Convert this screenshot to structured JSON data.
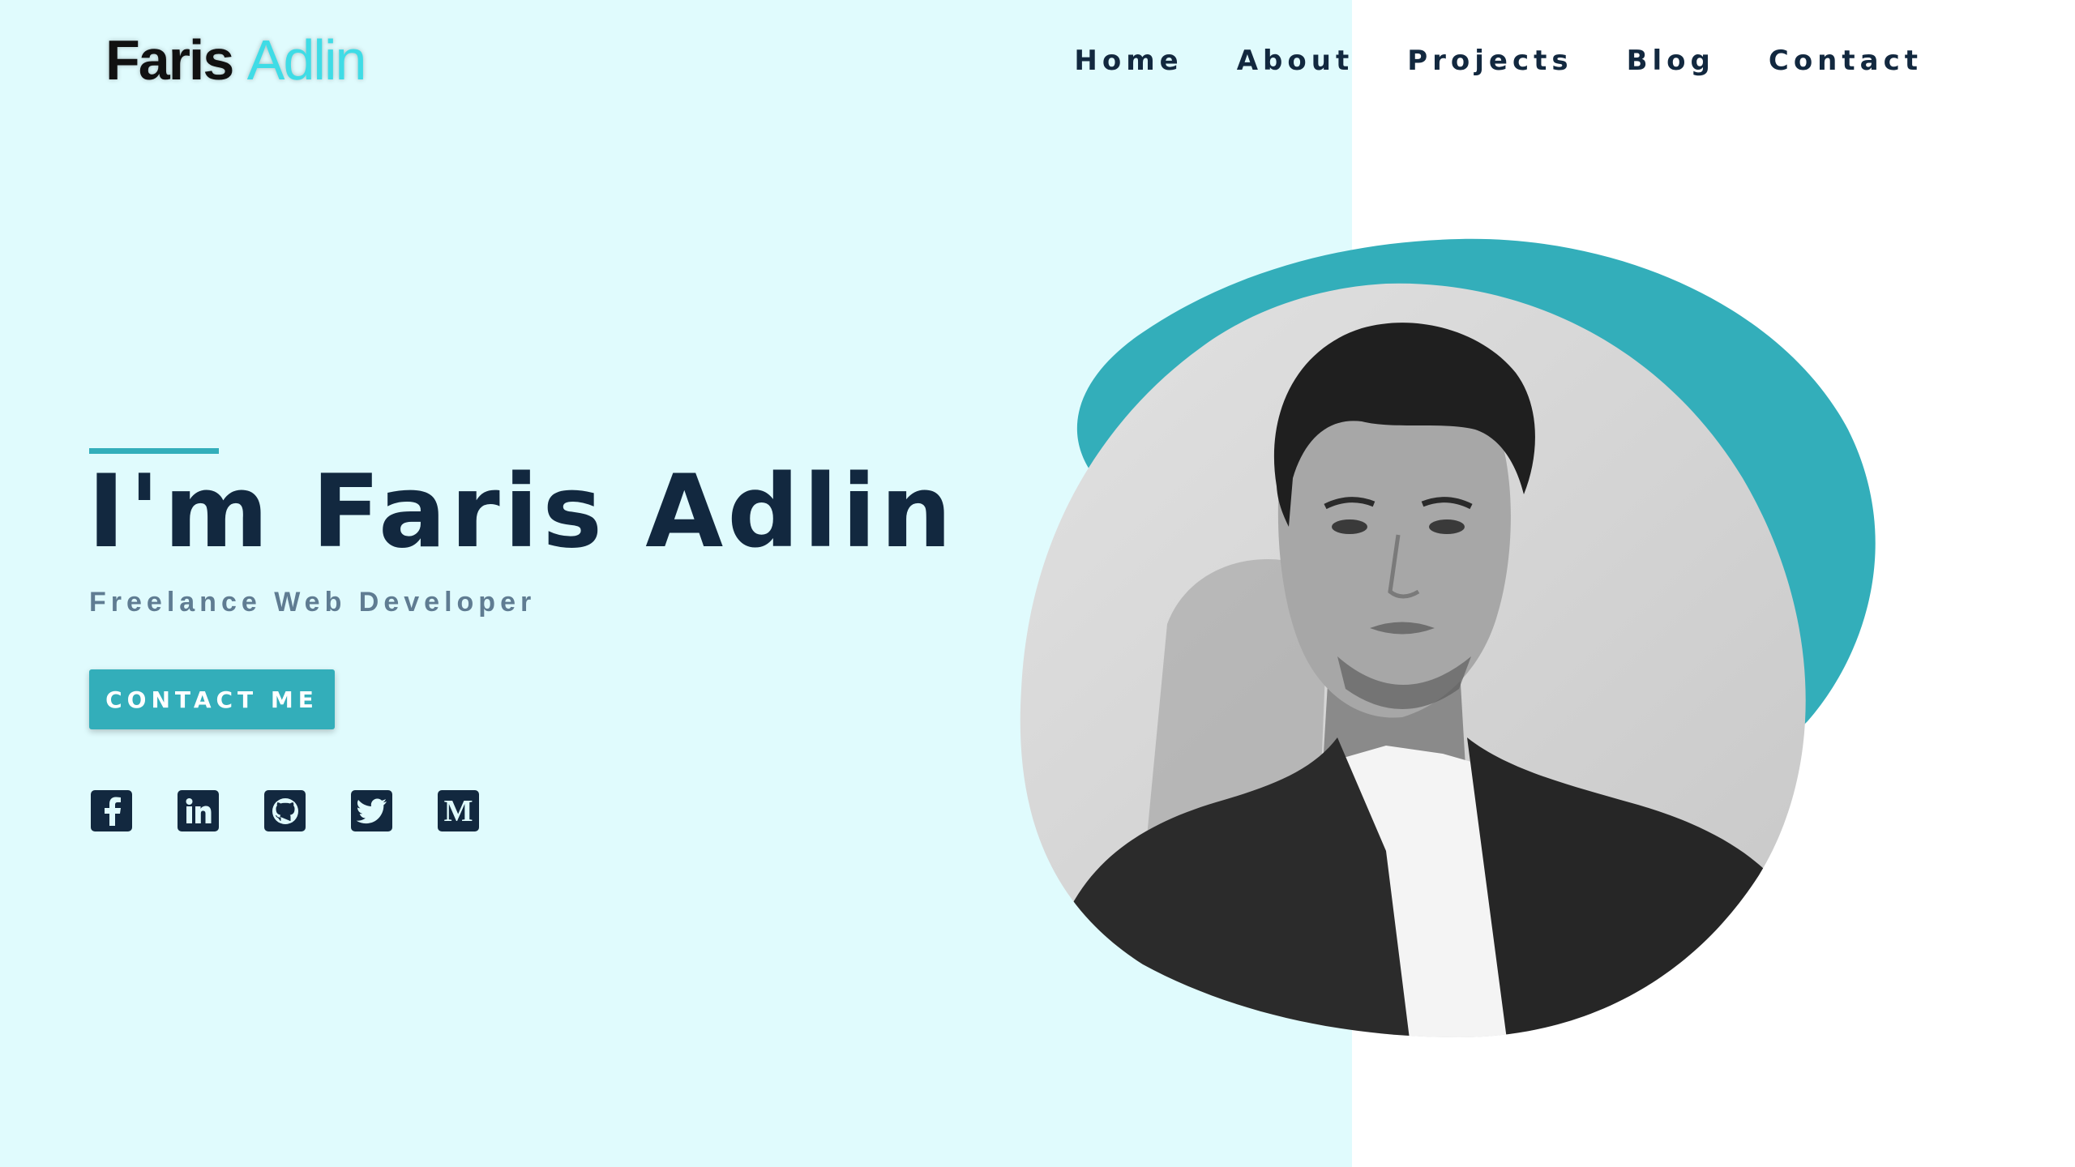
{
  "brand": {
    "first": "Faris",
    "second": "Adlin"
  },
  "nav": {
    "items": [
      {
        "label": "Home"
      },
      {
        "label": "About"
      },
      {
        "label": "Projects"
      },
      {
        "label": "Blog"
      },
      {
        "label": "Contact"
      }
    ]
  },
  "hero": {
    "title": "I'm Faris Adlin",
    "subtitle": "Freelance Web Developer",
    "cta_label": "CONTACT ME"
  },
  "socials": [
    {
      "icon": "facebook-icon"
    },
    {
      "icon": "linkedin-icon"
    },
    {
      "icon": "github-icon"
    },
    {
      "icon": "twitter-icon"
    },
    {
      "icon": "medium-icon",
      "glyph": "M"
    }
  ],
  "colors": {
    "accent": "#33aeba",
    "left_background": "#e0fbfd",
    "text_dark": "#12283f",
    "subtitle": "#5f7c92",
    "logo_accent": "#3fdce6"
  }
}
